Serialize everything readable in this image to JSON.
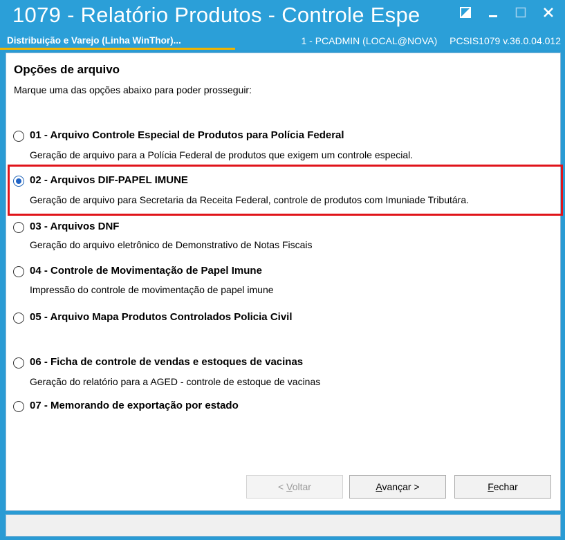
{
  "window": {
    "title": "1079 - Relatório Produtos - Controle Espe",
    "subtitle_left": "Distribuição e Varejo (Linha WinThor)...",
    "user_info": "1 - PCADMIN (LOCAL@NOVA)",
    "version_info": "PCSIS1079  v.36.0.04.012",
    "accent_color": "#2b9fd8"
  },
  "page": {
    "section_title": "Opções de arquivo",
    "instruction": "Marque uma das opções abaixo para poder prosseguir:"
  },
  "options": [
    {
      "label": "01 - Arquivo Controle Especial de Produtos para Polícia Federal",
      "desc": "Geração de arquivo para a Polícia Federal de produtos que exigem um controle especial.",
      "selected": false
    },
    {
      "label": "02 - Arquivos DIF-PAPEL IMUNE",
      "desc": "Geração de arquivo para Secretaria da Receita Federal, controle de produtos com Imuniade Tributára.",
      "selected": true
    },
    {
      "label": "03 - Arquivos DNF",
      "desc": "Geração do arquivo eletrônico de Demonstrativo de Notas Fiscais",
      "selected": false
    },
    {
      "label": "04 - Controle de Movimentação de Papel Imune",
      "desc": "Impressão do controle de movimentação de papel imune",
      "selected": false
    },
    {
      "label": "05 - Arquivo Mapa Produtos Controlados Policia Civil",
      "desc": "",
      "selected": false
    },
    {
      "label": "06 - Ficha de controle de vendas e estoques de vacinas",
      "desc": "Geração do relatório para a AGED - controle de estoque de vacinas",
      "selected": false
    },
    {
      "label": "07 - Memorando de exportação por estado",
      "desc": "",
      "selected": false
    }
  ],
  "buttons": {
    "back_prefix": "< ",
    "back_mnemonic": "V",
    "back_rest": "oltar",
    "next_mnemonic": "A",
    "next_rest": "vançar >",
    "close_mnemonic": "F",
    "close_rest": "echar"
  }
}
